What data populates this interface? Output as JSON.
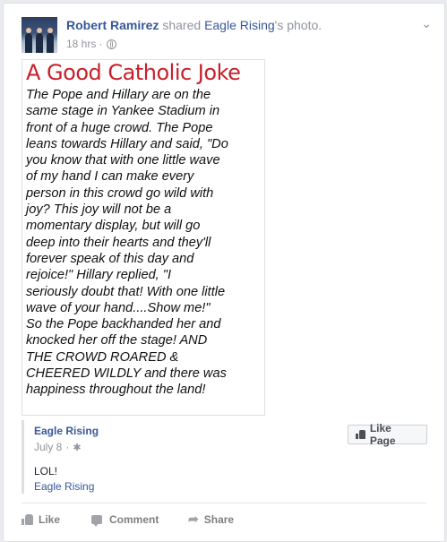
{
  "post": {
    "author": "Robert Ramirez",
    "action_text": "shared",
    "shared_from": "Eagle Rising",
    "shared_suffix": "'s photo.",
    "time": "18 hrs",
    "separator": "·"
  },
  "image": {
    "title": "A Good Catholic Joke",
    "lines": [
      "The Pope and Hillary are on the",
      "same stage in Yankee Stadium in",
      "front of a huge crowd.  The Pope",
      "leans towards Hillary and said, \"Do",
      "you know that with one little wave",
      "of my hand I can make every",
      "person in this crowd go wild with",
      "joy? This joy will not be a",
      "momentary display, but will go",
      "deep into their hearts and they'll",
      "forever speak of this day and",
      "rejoice!\"   Hillary replied, \"I",
      "seriously doubt that! With one little",
      "wave of your hand....Show me!\"",
      "So the Pope backhanded her and",
      "knocked her off the stage!  AND",
      "THE CROWD ROARED &",
      "CHEERED WILDLY and there was",
      "happiness throughout the land!"
    ]
  },
  "shared_post": {
    "page_name": "Eagle Rising",
    "date": "July 8",
    "separator": "·",
    "like_page_label": "Like Page",
    "text": "LOL!",
    "link": "Eagle Rising"
  },
  "actions": {
    "like": "Like",
    "comment": "Comment",
    "share": "Share"
  },
  "icons": {
    "menu": "chevron-down-icon",
    "privacy": "globe-icon",
    "settings": "gear-icon"
  }
}
